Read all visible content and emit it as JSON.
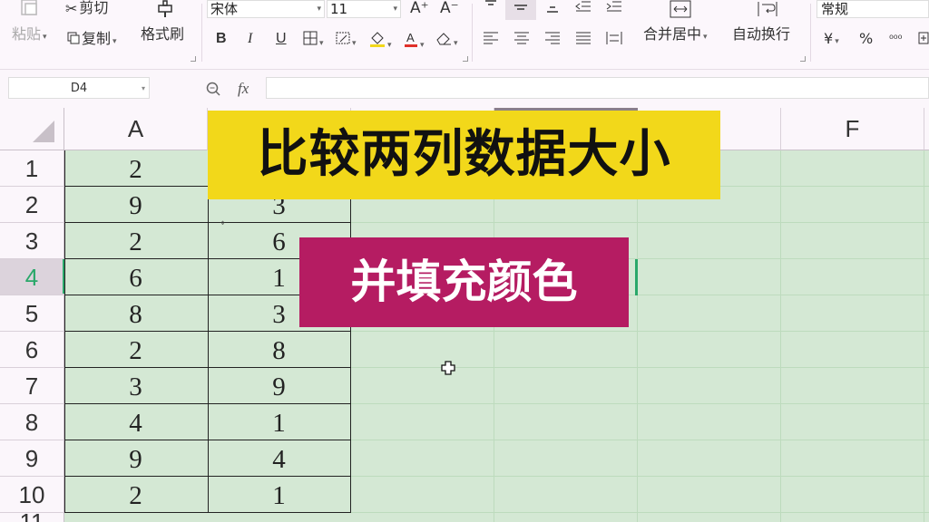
{
  "ribbon": {
    "paste_label": "粘贴",
    "cut_label": "剪切",
    "copy_label": "复制",
    "format_painter_label": "格式刷",
    "font_name": "宋体",
    "font_size": "11",
    "bold": "B",
    "italic": "I",
    "underline": "U",
    "grow_font": "A⁺",
    "shrink_font": "A⁻",
    "merge_center_label": "合并居中",
    "wrap_text_label": "自动换行",
    "number_format": "常规",
    "currency_symbol": "¥",
    "percent_symbol": "%"
  },
  "formula_bar": {
    "name_box": "D4",
    "fx_label": "fx",
    "formula": ""
  },
  "sheet": {
    "columns": [
      "A",
      "F"
    ],
    "rows": [
      "1",
      "2",
      "3",
      "4",
      "5",
      "6",
      "7",
      "8",
      "9",
      "10",
      "11"
    ],
    "selected_row": "4",
    "col_a": [
      "2",
      "9",
      "2",
      "6",
      "8",
      "2",
      "3",
      "4",
      "9",
      "2"
    ],
    "col_b": [
      "",
      "3",
      "6",
      "1",
      "3",
      "8",
      "9",
      "1",
      "4",
      "1"
    ]
  },
  "overlay": {
    "title": "比较两列数据大小",
    "subtitle": "并填充颜色",
    "title_bg": "#f2d81a",
    "subtitle_bg": "#b51c62"
  }
}
